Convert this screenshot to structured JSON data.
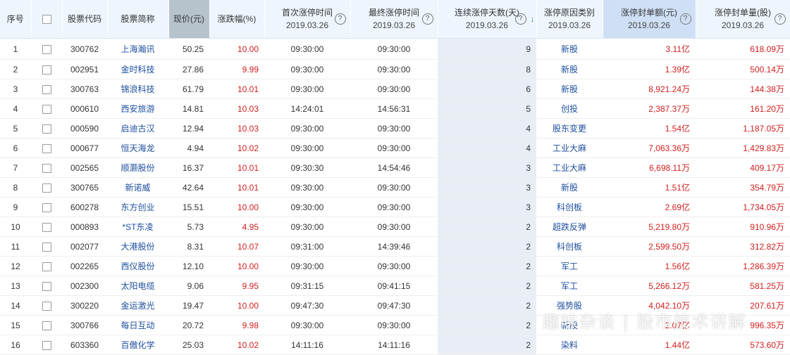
{
  "header": {
    "col_seq": "序号",
    "col_code": "股票代码",
    "col_name": "股票简称",
    "col_price": "现价(元)",
    "col_change": "涨跌幅(%)",
    "col_first_time": "首次涨停时间",
    "col_last_time": "最终涨停时间",
    "col_days": "连续涨停天数(天)",
    "col_reason": "涨停原因类别",
    "col_amount": "涨停封单额(元)",
    "col_volume": "涨停封单量(股)",
    "date": "2019.03.26",
    "help_glyph": "?",
    "sort_glyph": "↓"
  },
  "rows": [
    {
      "seq": "1",
      "code": "300762",
      "name": "上海瀚讯",
      "price": "50.25",
      "change": "10.00",
      "first": "09:30:00",
      "last": "09:30:00",
      "days": "9",
      "reason": "新股",
      "amount": "3.11亿",
      "volume": "618.09万"
    },
    {
      "seq": "2",
      "code": "002951",
      "name": "金时科技",
      "price": "27.86",
      "change": "9.99",
      "first": "09:30:00",
      "last": "09:30:00",
      "days": "8",
      "reason": "新股",
      "amount": "1.39亿",
      "volume": "500.14万"
    },
    {
      "seq": "3",
      "code": "300763",
      "name": "锦浪科技",
      "price": "61.79",
      "change": "10.01",
      "first": "09:30:00",
      "last": "09:30:00",
      "days": "6",
      "reason": "新股",
      "amount": "8,921.24万",
      "volume": "144.38万"
    },
    {
      "seq": "4",
      "code": "000610",
      "name": "西安旅游",
      "price": "14.81",
      "change": "10.03",
      "first": "14:24:01",
      "last": "14:56:31",
      "days": "5",
      "reason": "创投",
      "amount": "2,387.37万",
      "volume": "161.20万"
    },
    {
      "seq": "5",
      "code": "000590",
      "name": "启迪古汉",
      "price": "12.94",
      "change": "10.03",
      "first": "09:30:00",
      "last": "09:30:00",
      "days": "4",
      "reason": "股东变更",
      "amount": "1.54亿",
      "volume": "1,187.05万"
    },
    {
      "seq": "6",
      "code": "000677",
      "name": "恒天海龙",
      "price": "4.94",
      "change": "10.02",
      "first": "09:30:00",
      "last": "09:30:00",
      "days": "4",
      "reason": "工业大麻",
      "amount": "7,063.36万",
      "volume": "1,429.83万"
    },
    {
      "seq": "7",
      "code": "002565",
      "name": "顺灏股份",
      "price": "16.37",
      "change": "10.01",
      "first": "09:30:30",
      "last": "14:54:46",
      "days": "3",
      "reason": "工业大麻",
      "amount": "6,698.11万",
      "volume": "409.17万"
    },
    {
      "seq": "8",
      "code": "300765",
      "name": "新诺威",
      "price": "42.64",
      "change": "10.01",
      "first": "09:30:00",
      "last": "09:30:00",
      "days": "3",
      "reason": "新股",
      "amount": "1.51亿",
      "volume": "354.79万"
    },
    {
      "seq": "9",
      "code": "600278",
      "name": "东方创业",
      "price": "15.51",
      "change": "10.00",
      "first": "09:30:00",
      "last": "09:30:00",
      "days": "3",
      "reason": "科创板",
      "amount": "2.69亿",
      "volume": "1,734.05万"
    },
    {
      "seq": "10",
      "code": "000893",
      "name": "*ST东凌",
      "price": "5.73",
      "change": "4.95",
      "first": "09:30:00",
      "last": "09:30:00",
      "days": "2",
      "reason": "超跌反弹",
      "amount": "5,219.80万",
      "volume": "910.96万"
    },
    {
      "seq": "11",
      "code": "002077",
      "name": "大港股份",
      "price": "8.31",
      "change": "10.07",
      "first": "09:31:00",
      "last": "14:39:46",
      "days": "2",
      "reason": "科创板",
      "amount": "2,599.50万",
      "volume": "312.82万"
    },
    {
      "seq": "12",
      "code": "002265",
      "name": "西仪股份",
      "price": "12.10",
      "change": "10.00",
      "first": "09:30:00",
      "last": "09:30:00",
      "days": "2",
      "reason": "军工",
      "amount": "1.56亿",
      "volume": "1,286.39万"
    },
    {
      "seq": "13",
      "code": "002300",
      "name": "太阳电缆",
      "price": "9.06",
      "change": "9.95",
      "first": "09:31:15",
      "last": "09:41:15",
      "days": "2",
      "reason": "军工",
      "amount": "5,266.12万",
      "volume": "581.25万"
    },
    {
      "seq": "14",
      "code": "300220",
      "name": "金运激光",
      "price": "19.47",
      "change": "10.00",
      "first": "09:47:30",
      "last": "09:47:30",
      "days": "2",
      "reason": "强势股",
      "amount": "4,042.10万",
      "volume": "207.61万"
    },
    {
      "seq": "15",
      "code": "300766",
      "name": "每日互动",
      "price": "20.72",
      "change": "9.98",
      "first": "09:30:00",
      "last": "09:30:00",
      "days": "2",
      "reason": "新股",
      "amount": "2.07亿",
      "volume": "996.35万"
    },
    {
      "seq": "16",
      "code": "603360",
      "name": "百傲化学",
      "price": "25.03",
      "change": "10.02",
      "first": "14:11:16",
      "last": "14:11:16",
      "days": "2",
      "reason": "染料",
      "amount": "1.44亿",
      "volume": "573.60万"
    }
  ],
  "watermark": "趣味杂谈 | 股市技术讲解",
  "colors": {
    "header_bg": "#eef5fd",
    "price_sorted_bg": "#b7c3cc",
    "amount_sorted_bg": "#cfe0f6",
    "days_col_bg": "#e9eef6",
    "red": "#d21e1e",
    "link_blue": "#1d4e9e"
  }
}
